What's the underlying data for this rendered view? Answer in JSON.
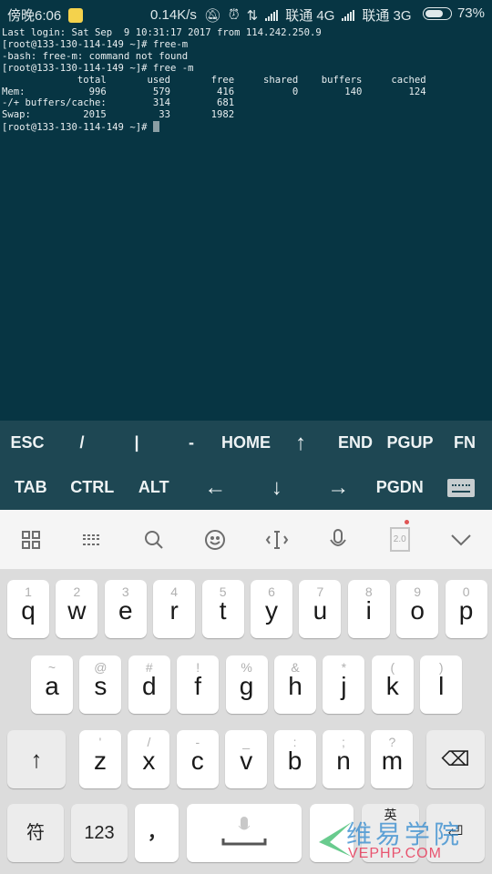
{
  "status_bar": {
    "time": "傍晚6:06",
    "net_speed": "0.14K/s",
    "carrier1": "联通 4G",
    "carrier2": "联通 3G",
    "battery": "73%",
    "battery_level": 0.73
  },
  "terminal": {
    "lines": [
      "Last login: Sat Sep  9 10:31:17 2017 from 114.242.250.9",
      "[root@133-130-114-149 ~]# free-m",
      "-bash: free-m: command not found",
      "[root@133-130-114-149 ~]# free -m",
      "             total       used       free     shared    buffers     cached",
      "Mem:           996        579        416          0        140        124",
      "-/+ buffers/cache:        314        681",
      "Swap:         2015         33       1982"
    ],
    "prompt": "[root@133-130-114-149 ~]# "
  },
  "extra_keys": {
    "row1": [
      "ESC",
      "/",
      "|",
      "-",
      "HOME",
      "↑",
      "END",
      "PGUP",
      "FN"
    ],
    "row2": [
      "TAB",
      "CTRL",
      "ALT",
      "←",
      "↓",
      "→",
      "PGDN"
    ]
  },
  "ime_toolbar": {
    "version_badge": "2.0"
  },
  "keyboard": {
    "row1": [
      {
        "k": "q",
        "s": "1"
      },
      {
        "k": "w",
        "s": "2"
      },
      {
        "k": "e",
        "s": "3"
      },
      {
        "k": "r",
        "s": "4"
      },
      {
        "k": "t",
        "s": "5"
      },
      {
        "k": "y",
        "s": "6"
      },
      {
        "k": "u",
        "s": "7"
      },
      {
        "k": "i",
        "s": "8"
      },
      {
        "k": "o",
        "s": "9"
      },
      {
        "k": "p",
        "s": "0"
      }
    ],
    "row2": [
      {
        "k": "a",
        "s": "~"
      },
      {
        "k": "s",
        "s": "@"
      },
      {
        "k": "d",
        "s": "#"
      },
      {
        "k": "f",
        "s": "!"
      },
      {
        "k": "g",
        "s": "%"
      },
      {
        "k": "h",
        "s": "&"
      },
      {
        "k": "j",
        "s": "*"
      },
      {
        "k": "k",
        "s": "("
      },
      {
        "k": "l",
        "s": ")"
      }
    ],
    "row3": [
      {
        "k": "z",
        "s": "'"
      },
      {
        "k": "x",
        "s": "/"
      },
      {
        "k": "c",
        "s": "-"
      },
      {
        "k": "v",
        "s": "_"
      },
      {
        "k": "b",
        "s": ":"
      },
      {
        "k": "n",
        "s": ";"
      },
      {
        "k": "m",
        "s": "?"
      }
    ],
    "symbols_label": "符",
    "numbers_label": "123",
    "comma_label": "，",
    "lang_label": "英"
  },
  "watermark": {
    "cn": "维易学院",
    "en": "VEPHP.COM"
  }
}
